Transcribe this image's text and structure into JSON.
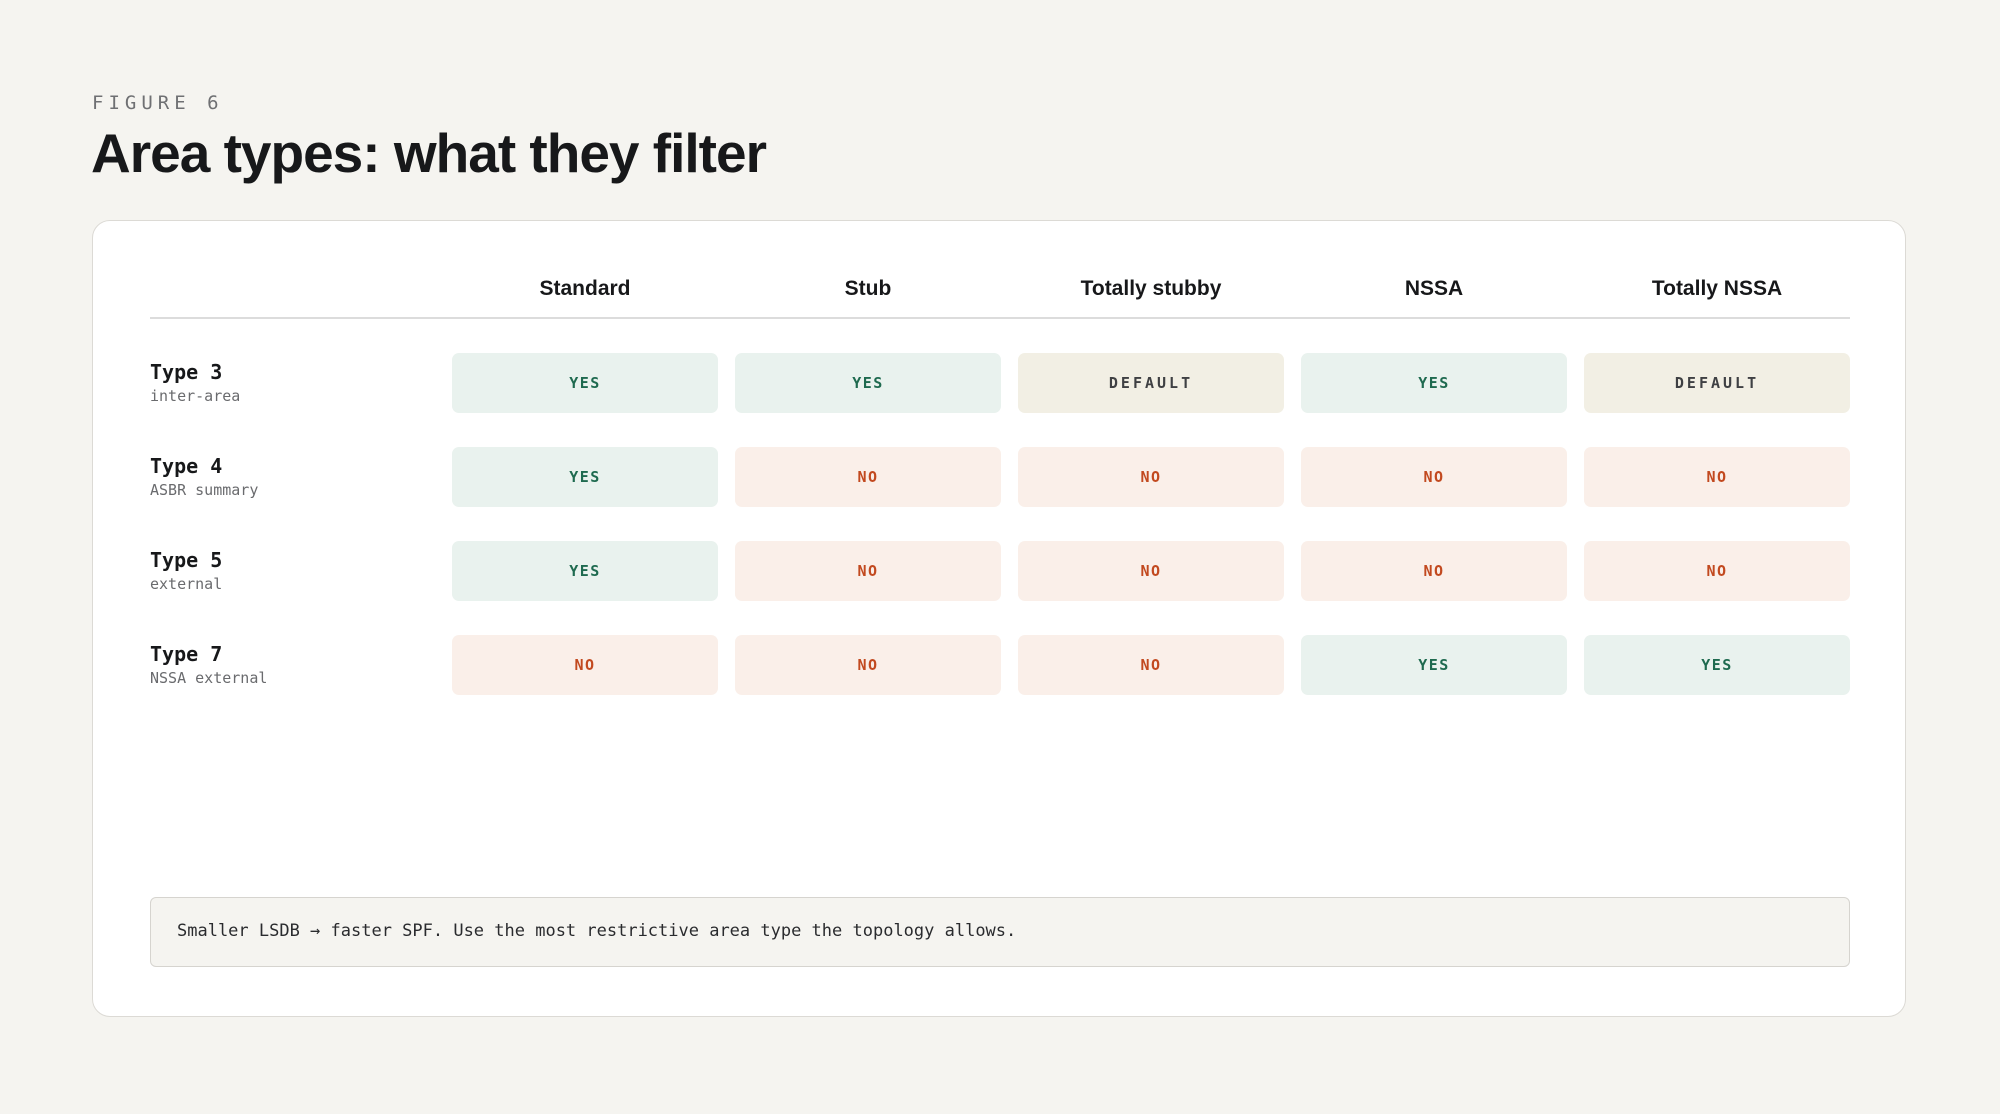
{
  "figure_label": "FIGURE 6",
  "title": "Area types: what they filter",
  "columns": [
    "Standard",
    "Stub",
    "Totally stubby",
    "NSSA",
    "Totally NSSA"
  ],
  "rows": [
    {
      "name": "Type 3",
      "sub": "inter-area",
      "cells": [
        "YES",
        "YES",
        "DEFAULT",
        "YES",
        "DEFAULT"
      ]
    },
    {
      "name": "Type 4",
      "sub": "ASBR summary",
      "cells": [
        "YES",
        "NO",
        "NO",
        "NO",
        "NO"
      ]
    },
    {
      "name": "Type 5",
      "sub": "external",
      "cells": [
        "YES",
        "NO",
        "NO",
        "NO",
        "NO"
      ]
    },
    {
      "name": "Type 7",
      "sub": "NSSA external",
      "cells": [
        "NO",
        "NO",
        "NO",
        "YES",
        "YES"
      ]
    }
  ],
  "note": "Smaller LSDB → faster SPF. Use the most restrictive area type the topology allows.",
  "colors": {
    "yes_bg": "#e9f2ee",
    "yes_text": "#1e6a4f",
    "no_bg": "#faefe9",
    "no_text": "#c2491f",
    "default_bg": "#f2efe4",
    "default_text": "#3f4043"
  }
}
